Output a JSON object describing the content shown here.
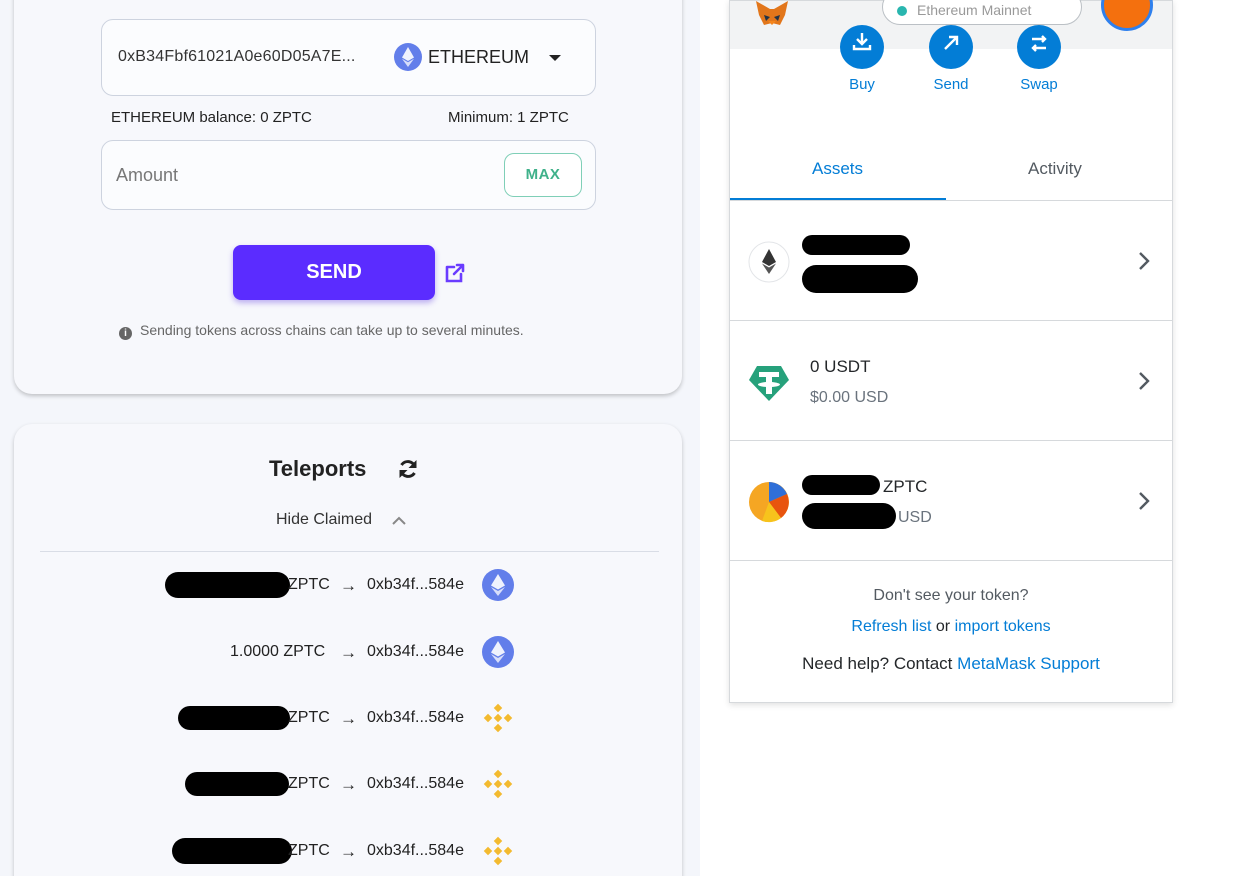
{
  "bridge": {
    "address": "0xB34Fbf61021A0e60D05A7E...",
    "chain_label": "ETHEREUM",
    "balance_text": "ETHEREUM balance: 0 ZPTC",
    "minimum_text": "Minimum: 1 ZPTC",
    "amount_placeholder": "Amount",
    "max_label": "MAX",
    "send_label": "SEND",
    "info_text": "Sending tokens across chains can take up to several minutes."
  },
  "teleports": {
    "title": "Teleports",
    "hide_claimed_label": "Hide Claimed",
    "rows": [
      {
        "amount": "ZPTC",
        "address": "0xb34f...584e",
        "chain": "ethereum",
        "redacted": true
      },
      {
        "amount": "1.0000 ZPTC",
        "address": "0xb34f...584e",
        "chain": "ethereum",
        "redacted": false
      },
      {
        "amount": "ZPTC",
        "address": "0xb34f...584e",
        "chain": "bnb",
        "redacted": true
      },
      {
        "amount": "ZPTC",
        "address": "0xb34f...584e",
        "chain": "bnb",
        "redacted": true
      },
      {
        "amount": "ZPTC",
        "address": "0xb34f...584e",
        "chain": "bnb",
        "redacted": true
      }
    ]
  },
  "metamask": {
    "network_label": "Ethereum Mainnet",
    "actions": {
      "buy": "Buy",
      "send": "Send",
      "swap": "Swap"
    },
    "tabs": {
      "assets": "Assets",
      "activity": "Activity"
    },
    "assets": [
      {
        "primary": "",
        "secondary": "",
        "icon": "ethereum-icon"
      },
      {
        "primary": "0 USDT",
        "secondary": "$0.00 USD",
        "icon": "tether-icon"
      },
      {
        "primary": "ZPTC",
        "secondary": "USD",
        "icon": "zptc-token-icon"
      }
    ],
    "footer": {
      "question": "Don't see your token?",
      "refresh_link": "Refresh list",
      "or_text": "or",
      "import_link": "import tokens",
      "help_text": "Need help? Contact",
      "support_link": "MetaMask Support"
    }
  },
  "colors": {
    "send_button": "#5b2cff",
    "max_accent": "#3fb18a",
    "metamask_blue": "#037dd6",
    "ethereum_icon": "#627eea",
    "bnb_icon": "#f3ba2f",
    "tether_icon": "#26a17b"
  }
}
